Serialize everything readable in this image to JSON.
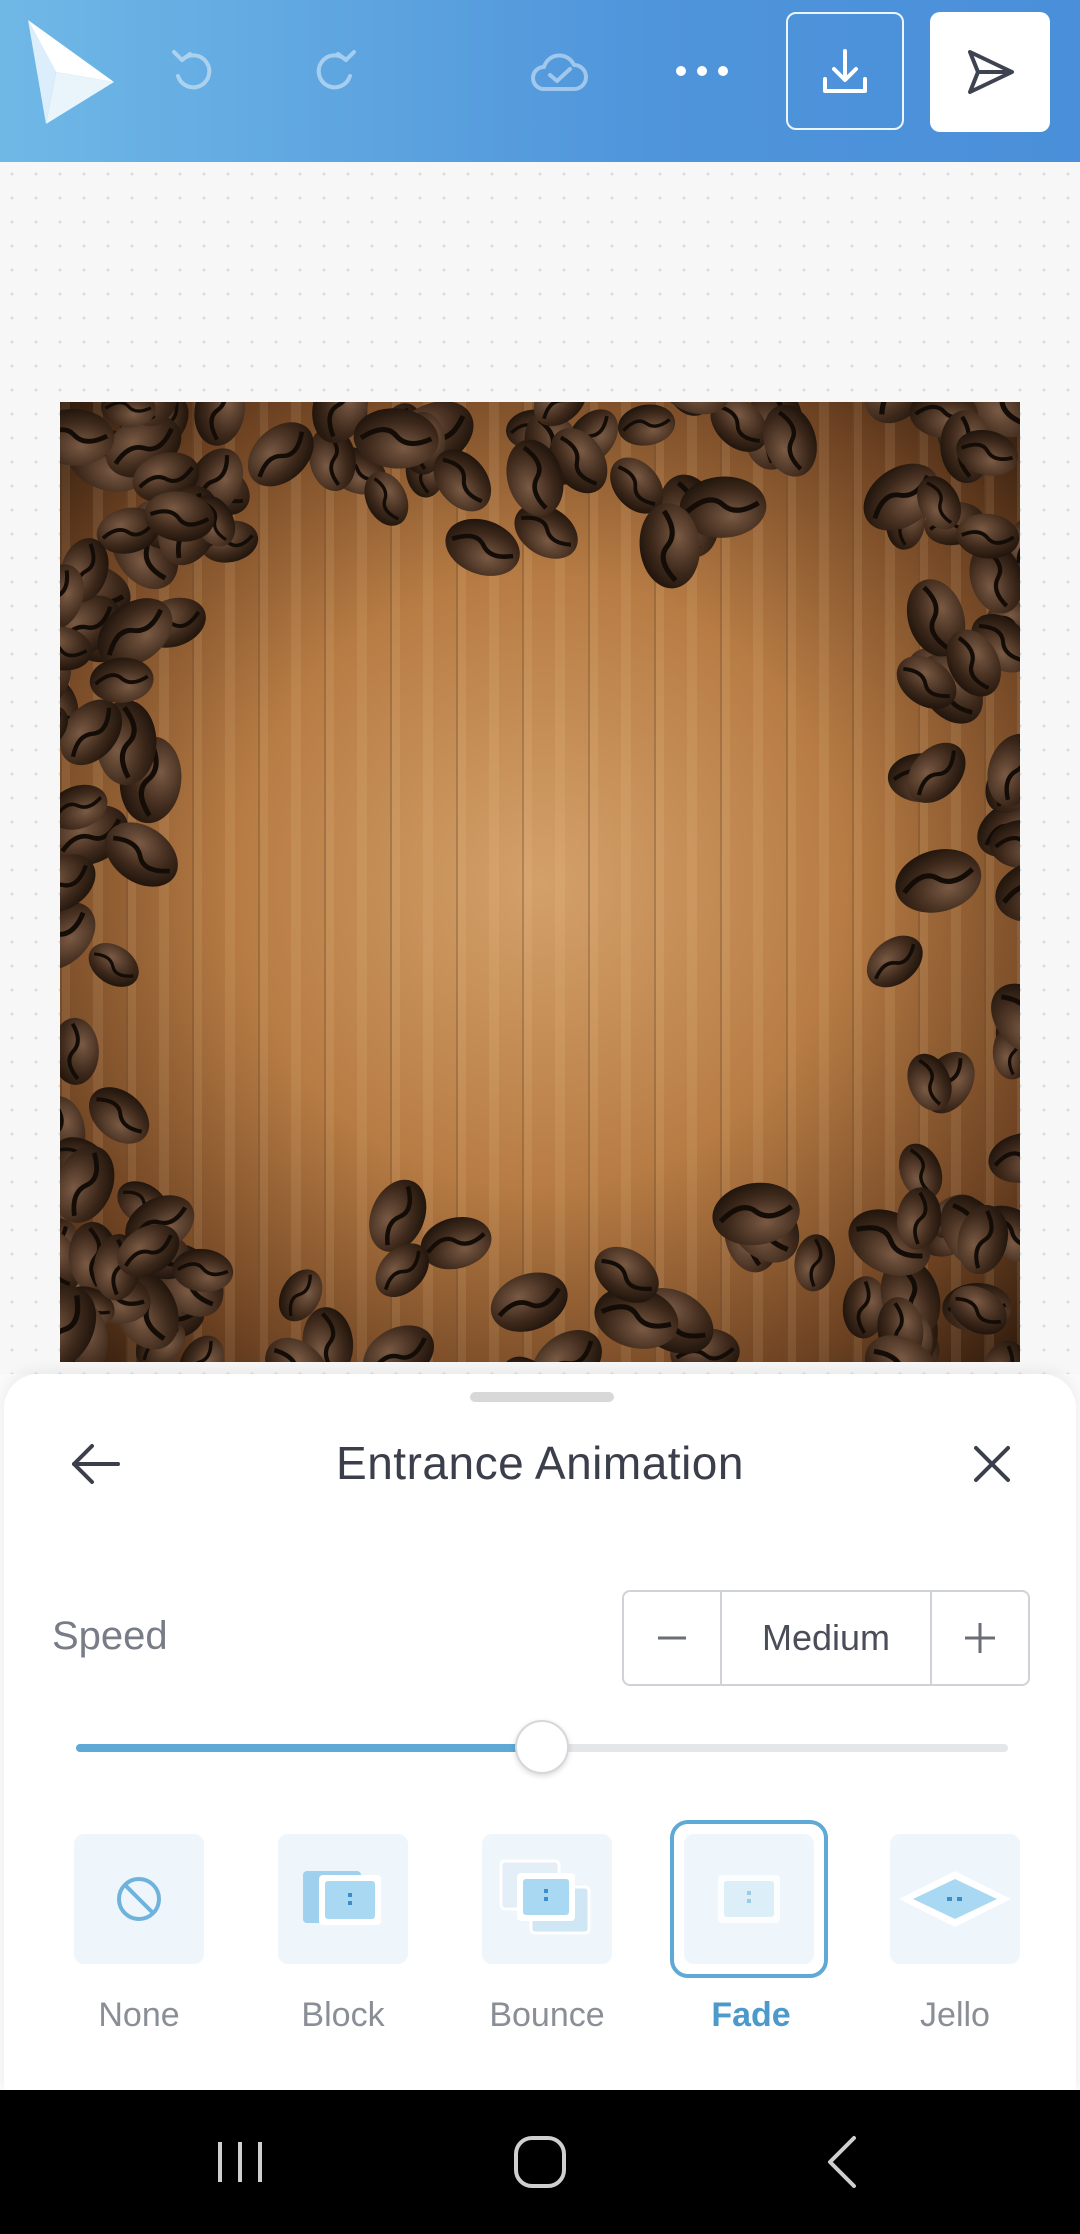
{
  "header": {
    "icons": [
      "app-logo",
      "undo-icon",
      "redo-icon",
      "cloud-check-icon",
      "more-icon",
      "download-icon",
      "send-icon"
    ],
    "accent_colors": [
      "#6fb8e6",
      "#4a8fd9"
    ]
  },
  "canvas": {
    "image": "coffee beans frame on wooden background"
  },
  "sheet": {
    "title": "Entrance Animation",
    "speed_label": "Speed",
    "speed_value": "Medium",
    "slider_level": 0.5,
    "options": [
      {
        "label": "None",
        "icon": "none-icon",
        "selected": false
      },
      {
        "label": "Block",
        "icon": "block-animation-icon",
        "selected": false
      },
      {
        "label": "Bounce",
        "icon": "bounce-animation-icon",
        "selected": false
      },
      {
        "label": "Fade",
        "icon": "fade-animation-icon",
        "selected": true
      },
      {
        "label": "Jello",
        "icon": "jello-animation-icon",
        "selected": false
      }
    ],
    "accent_color": "#5fa9d6"
  },
  "navbar": {
    "buttons": [
      "recent-apps-icon",
      "home-icon",
      "back-icon"
    ]
  }
}
